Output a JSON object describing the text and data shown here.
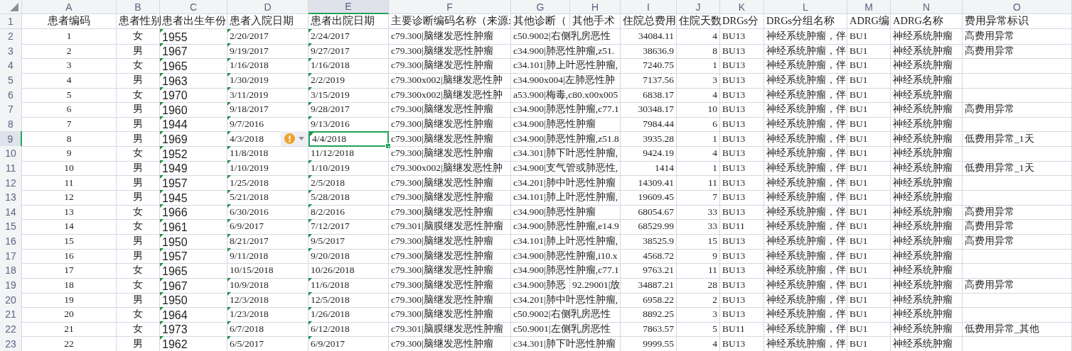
{
  "sheet": {
    "columns": [
      {
        "label": "A",
        "selected": false
      },
      {
        "label": "B",
        "selected": false
      },
      {
        "label": "C",
        "selected": false
      },
      {
        "label": "D",
        "selected": false
      },
      {
        "label": "E",
        "selected": true
      },
      {
        "label": "F",
        "selected": false
      },
      {
        "label": "G",
        "selected": false
      },
      {
        "label": "H",
        "selected": false
      },
      {
        "label": "I",
        "selected": false
      },
      {
        "label": "J",
        "selected": false
      },
      {
        "label": "K",
        "selected": false
      },
      {
        "label": "L",
        "selected": false
      },
      {
        "label": "M",
        "selected": false
      },
      {
        "label": "N",
        "selected": false
      },
      {
        "label": "O",
        "selected": false
      }
    ],
    "header_row": {
      "number": "1",
      "selected": false,
      "cells": [
        "患者编码",
        "患者性别",
        "患者出生年份",
        "患者入院日期",
        "患者出院日期",
        "主要诊断编码名称（来源:",
        "其他诊断（",
        "其他手术",
        "住院总费用",
        "住院天数",
        "DRGs分",
        "DRGs分组名称",
        "ADRG编",
        "ADRG名称",
        "费用异常标识"
      ]
    },
    "rows": [
      {
        "number": "2",
        "selected": false,
        "id": "1",
        "sex": "女",
        "birth_year": "1955",
        "admit_date": "2/20/2017",
        "discharge_date": "2/24/2017",
        "main_diagnosis": "c79.300|脑继发恶性肿瘤",
        "other_diagnosis": "c50.9002|右侧乳房恶性",
        "total_cost": "34084.11",
        "days": "4",
        "drg_code": "BU13",
        "drg_name": "神经系统肿瘤，伴",
        "adrg_code": "BU1",
        "adrg_name": "神经系统肿瘤",
        "cost_flag": "高费用异常",
        "markers": [
          true,
          true,
          true
        ],
        "admit_warning": false,
        "discharge_cell_selected": false
      },
      {
        "number": "3",
        "selected": false,
        "id": "2",
        "sex": "男",
        "birth_year": "1967",
        "admit_date": "9/19/2017",
        "discharge_date": "9/27/2017",
        "main_diagnosis": "c79.300|脑继发恶性肿瘤",
        "other_diagnosis": "c34.900|肺恶性肿瘤,z51.",
        "total_cost": "38636.9",
        "days": "8",
        "drg_code": "BU13",
        "drg_name": "神经系统肿瘤，伴",
        "adrg_code": "BU1",
        "adrg_name": "神经系统肿瘤",
        "cost_flag": "高费用异常",
        "markers": [
          true,
          true,
          true
        ],
        "admit_warning": false,
        "discharge_cell_selected": false
      },
      {
        "number": "4",
        "selected": false,
        "id": "3",
        "sex": "女",
        "birth_year": "1965",
        "admit_date": "1/16/2018",
        "discharge_date": "1/16/2018",
        "main_diagnosis": "c79.300|脑继发恶性肿瘤",
        "other_diagnosis": "c34.101|肺上叶恶性肿瘤,",
        "total_cost": "7240.75",
        "days": "1",
        "drg_code": "BU13",
        "drg_name": "神经系统肿瘤，伴",
        "adrg_code": "BU1",
        "adrg_name": "神经系统肿瘤",
        "markers": [
          true,
          true,
          true
        ],
        "admit_warning": false,
        "discharge_cell_selected": false
      },
      {
        "number": "5",
        "selected": false,
        "id": "4",
        "sex": "男",
        "birth_year": "1963",
        "admit_date": "1/30/2019",
        "discharge_date": "2/2/2019",
        "main_diagnosis": "c79.300x002|脑继发恶性肿",
        "other_diagnosis": "c34.900x004|左肺恶性肿",
        "total_cost": "7137.56",
        "days": "3",
        "drg_code": "BU13",
        "drg_name": "神经系统肿瘤，伴",
        "adrg_code": "BU1",
        "adrg_name": "神经系统肿瘤",
        "markers": [
          true,
          true,
          true
        ],
        "admit_warning": false,
        "discharge_cell_selected": false
      },
      {
        "number": "6",
        "selected": false,
        "id": "5",
        "sex": "女",
        "birth_year": "1970",
        "admit_date": "3/11/2019",
        "discharge_date": "3/15/2019",
        "main_diagnosis": "c79.300x002|脑继发恶性肿",
        "other_diagnosis": "a53.900|梅毒,c80.x00x005",
        "total_cost": "6838.17",
        "days": "4",
        "drg_code": "BU13",
        "drg_name": "神经系统肿瘤，伴",
        "adrg_code": "BU1",
        "adrg_name": "神经系统肿瘤",
        "markers": [
          true,
          true,
          true
        ],
        "admit_warning": false,
        "discharge_cell_selected": false
      },
      {
        "number": "7",
        "selected": false,
        "id": "6",
        "sex": "男",
        "birth_year": "1960",
        "admit_date": "9/18/2017",
        "discharge_date": "9/28/2017",
        "main_diagnosis": "c79.300|脑继发恶性肿瘤",
        "other_diagnosis": "c34.900|肺恶性肿瘤,c77.1",
        "total_cost": "30348.17",
        "days": "10",
        "drg_code": "BU13",
        "drg_name": "神经系统肿瘤，伴",
        "adrg_code": "BU1",
        "adrg_name": "神经系统肿瘤",
        "cost_flag": "高费用异常",
        "markers": [
          true,
          true,
          true
        ],
        "admit_warning": false,
        "discharge_cell_selected": false
      },
      {
        "number": "8",
        "selected": false,
        "id": "7",
        "sex": "男",
        "birth_year": "1944",
        "admit_date": "9/7/2016",
        "discharge_date": "9/13/2016",
        "main_diagnosis": "c79.300|脑继发恶性肿瘤",
        "other_diagnosis": "c34.900|肺恶性肿瘤",
        "total_cost": "7984.44",
        "days": "6",
        "drg_code": "BU13",
        "drg_name": "神经系统肿瘤，伴",
        "adrg_code": "BU1",
        "adrg_name": "神经系统肿瘤",
        "markers": [
          true,
          true,
          true
        ],
        "admit_warning": false,
        "discharge_cell_selected": false
      },
      {
        "number": "9",
        "selected": true,
        "id": "8",
        "sex": "男",
        "birth_year": "1969",
        "admit_date": "4/3/2018",
        "discharge_date": "4/4/2018",
        "main_diagnosis": "c79.300|脑继发恶性肿瘤",
        "other_diagnosis": "c34.900|肺恶性肿瘤,z51.8",
        "total_cost": "3935.28",
        "days": "1",
        "drg_code": "BU13",
        "drg_name": "神经系统肿瘤，伴",
        "adrg_code": "BU1",
        "adrg_name": "神经系统肿瘤",
        "cost_flag": "低费用异常_1天",
        "markers": [
          true,
          true,
          true
        ],
        "admit_warning": true,
        "discharge_cell_selected": true
      },
      {
        "number": "10",
        "selected": false,
        "id": "9",
        "sex": "女",
        "birth_year": "1952",
        "admit_date": "11/8/2018",
        "discharge_date": "11/12/2018",
        "main_diagnosis": "c79.300|脑继发恶性肿瘤",
        "other_diagnosis": "c34.301|肺下叶恶性肿瘤,",
        "total_cost": "9424.19",
        "days": "4",
        "drg_code": "BU13",
        "drg_name": "神经系统肿瘤，伴",
        "adrg_code": "BU1",
        "adrg_name": "神经系统肿瘤",
        "markers": [
          true,
          true,
          false
        ],
        "admit_warning": false,
        "discharge_cell_selected": false
      },
      {
        "number": "11",
        "selected": false,
        "id": "10",
        "sex": "男",
        "birth_year": "1949",
        "admit_date": "1/10/2019",
        "discharge_date": "1/10/2019",
        "main_diagnosis": "c79.300x002|脑继发恶性肿",
        "other_diagnosis": "c34.900|支气管或肺恶性,",
        "total_cost": "1414",
        "days": "1",
        "drg_code": "BU13",
        "drg_name": "神经系统肿瘤，伴",
        "adrg_code": "BU1",
        "adrg_name": "神经系统肿瘤",
        "cost_flag": "低费用异常_1天",
        "markers": [
          true,
          true,
          true
        ],
        "admit_warning": false,
        "discharge_cell_selected": false
      },
      {
        "number": "12",
        "selected": false,
        "id": "11",
        "sex": "男",
        "birth_year": "1957",
        "admit_date": "1/25/2018",
        "discharge_date": "2/5/2018",
        "main_diagnosis": "c79.300|脑继发恶性肿瘤",
        "other_diagnosis": "c34.201|肺中叶恶性肿瘤",
        "total_cost": "14309.41",
        "days": "11",
        "drg_code": "BU13",
        "drg_name": "神经系统肿瘤，伴",
        "adrg_code": "BU1",
        "adrg_name": "神经系统肿瘤",
        "markers": [
          true,
          true,
          true
        ],
        "admit_warning": false,
        "discharge_cell_selected": false
      },
      {
        "number": "13",
        "selected": false,
        "id": "12",
        "sex": "男",
        "birth_year": "1945",
        "admit_date": "5/21/2018",
        "discharge_date": "5/28/2018",
        "main_diagnosis": "c79.300|脑继发恶性肿瘤",
        "other_diagnosis": "c34.101|肺上叶恶性肿瘤,",
        "total_cost": "19609.45",
        "days": "7",
        "drg_code": "BU13",
        "drg_name": "神经系统肿瘤，伴",
        "adrg_code": "BU1",
        "adrg_name": "神经系统肿瘤",
        "markers": [
          true,
          true,
          true
        ],
        "admit_warning": false,
        "discharge_cell_selected": false
      },
      {
        "number": "14",
        "selected": false,
        "id": "13",
        "sex": "女",
        "birth_year": "1966",
        "admit_date": "6/30/2016",
        "discharge_date": "8/2/2016",
        "main_diagnosis": "c79.300|脑继发恶性肿瘤",
        "other_diagnosis": "c34.900|肺恶性肿瘤",
        "total_cost": "68054.67",
        "days": "33",
        "drg_code": "BU13",
        "drg_name": "神经系统肿瘤，伴",
        "adrg_code": "BU1",
        "adrg_name": "神经系统肿瘤",
        "cost_flag": "高费用异常",
        "markers": [
          true,
          true,
          true
        ],
        "admit_warning": false,
        "discharge_cell_selected": false
      },
      {
        "number": "15",
        "selected": false,
        "id": "14",
        "sex": "女",
        "birth_year": "1961",
        "admit_date": "6/9/2017",
        "discharge_date": "7/12/2017",
        "main_diagnosis": "c79.301|脑膜继发恶性肿瘤",
        "other_diagnosis": "c34.900|肺恶性肿瘤,e14.9",
        "total_cost": "68529.99",
        "days": "33",
        "drg_code": "BU11",
        "drg_name": "神经系统肿瘤，伴",
        "adrg_code": "BU1",
        "adrg_name": "神经系统肿瘤",
        "cost_flag": "高费用异常",
        "markers": [
          true,
          true,
          true
        ],
        "admit_warning": false,
        "discharge_cell_selected": false
      },
      {
        "number": "16",
        "selected": false,
        "id": "15",
        "sex": "男",
        "birth_year": "1950",
        "admit_date": "8/21/2017",
        "discharge_date": "9/5/2017",
        "main_diagnosis": "c79.300|脑继发恶性肿瘤",
        "other_diagnosis": "c34.101|肺上叶恶性肿瘤,",
        "total_cost": "38525.9",
        "days": "15",
        "drg_code": "BU13",
        "drg_name": "神经系统肿瘤，伴",
        "adrg_code": "BU1",
        "adrg_name": "神经系统肿瘤",
        "cost_flag": "高费用异常",
        "markers": [
          true,
          true,
          true
        ],
        "admit_warning": false,
        "discharge_cell_selected": false
      },
      {
        "number": "17",
        "selected": false,
        "id": "16",
        "sex": "男",
        "birth_year": "1957",
        "admit_date": "9/11/2018",
        "discharge_date": "9/20/2018",
        "main_diagnosis": "c79.300|脑继发恶性肿瘤",
        "other_diagnosis": "c34.900|肺恶性肿瘤,i10.x",
        "total_cost": "4568.72",
        "days": "9",
        "drg_code": "BU13",
        "drg_name": "神经系统肿瘤，伴",
        "adrg_code": "BU1",
        "adrg_name": "神经系统肿瘤",
        "markers": [
          true,
          true,
          true
        ],
        "admit_warning": false,
        "discharge_cell_selected": false
      },
      {
        "number": "18",
        "selected": false,
        "id": "17",
        "sex": "女",
        "birth_year": "1965",
        "admit_date": "10/15/2018",
        "discharge_date": "10/26/2018",
        "main_diagnosis": "c79.300|脑继发恶性肿瘤",
        "other_diagnosis": "c34.900|肺恶性肿瘤,c77.1",
        "total_cost": "9763.21",
        "days": "11",
        "drg_code": "BU13",
        "drg_name": "神经系统肿瘤，伴",
        "adrg_code": "BU1",
        "adrg_name": "神经系统肿瘤",
        "markers": [
          true,
          false,
          false
        ],
        "admit_warning": false,
        "discharge_cell_selected": false
      },
      {
        "number": "19",
        "selected": false,
        "id": "18",
        "sex": "女",
        "birth_year": "1967",
        "admit_date": "10/9/2018",
        "discharge_date": "11/6/2018",
        "main_diagnosis": "c79.300|脑继发恶性肿瘤",
        "other_diagnosis": "c34.900|肺恶",
        "other_surgery": "92.29001|放",
        "total_cost": "34887.21",
        "days": "28",
        "drg_code": "BU13",
        "drg_name": "神经系统肿瘤，伴",
        "adrg_code": "BU1",
        "adrg_name": "神经系统肿瘤",
        "cost_flag": "高费用异常",
        "markers": [
          true,
          true,
          true
        ],
        "admit_warning": false,
        "discharge_cell_selected": false
      },
      {
        "number": "20",
        "selected": false,
        "id": "19",
        "sex": "男",
        "birth_year": "1950",
        "admit_date": "12/3/2018",
        "discharge_date": "12/5/2018",
        "main_diagnosis": "c79.300|脑继发恶性肿瘤",
        "other_diagnosis": "c34.201|肺中叶恶性肿瘤,",
        "total_cost": "6958.22",
        "days": "2",
        "drg_code": "BU13",
        "drg_name": "神经系统肿瘤，伴",
        "adrg_code": "BU1",
        "adrg_name": "神经系统肿瘤",
        "markers": [
          true,
          true,
          true
        ],
        "admit_warning": false,
        "discharge_cell_selected": false
      },
      {
        "number": "21",
        "selected": false,
        "id": "20",
        "sex": "女",
        "birth_year": "1964",
        "admit_date": "1/23/2018",
        "discharge_date": "1/26/2018",
        "main_diagnosis": "c79.300|脑继发恶性肿瘤",
        "other_diagnosis": "c50.9002|右侧乳房恶性",
        "total_cost": "8892.25",
        "days": "3",
        "drg_code": "BU13",
        "drg_name": "神经系统肿瘤，伴",
        "adrg_code": "BU1",
        "adrg_name": "神经系统肿瘤",
        "markers": [
          true,
          true,
          true
        ],
        "admit_warning": false,
        "discharge_cell_selected": false
      },
      {
        "number": "22",
        "selected": false,
        "id": "21",
        "sex": "女",
        "birth_year": "1973",
        "admit_date": "6/7/2018",
        "discharge_date": "6/12/2018",
        "main_diagnosis": "c79.301|脑膜继发恶性肿瘤",
        "other_diagnosis": "c50.9001|左侧乳房恶性",
        "total_cost": "7863.57",
        "days": "5",
        "drg_code": "BU11",
        "drg_name": "神经系统肿瘤，伴",
        "adrg_code": "BU1",
        "adrg_name": "神经系统肿瘤",
        "cost_flag": "低费用异常_其他",
        "markers": [
          true,
          true,
          true
        ],
        "admit_warning": false,
        "discharge_cell_selected": false
      },
      {
        "number": "23",
        "selected": false,
        "id": "22",
        "sex": "男",
        "birth_year": "1962",
        "admit_date": "6/5/2017",
        "discharge_date": "6/9/2017",
        "main_diagnosis": "c79.300|脑继发恶性肿瘤",
        "other_diagnosis": "c34.301|肺下叶恶性肿瘤",
        "total_cost": "9999.55",
        "days": "4",
        "drg_code": "BU13",
        "drg_name": "神经系统肿瘤，伴",
        "adrg_code": "BU1",
        "adrg_name": "神经系统肿瘤",
        "markers": [
          true,
          true,
          true
        ],
        "admit_warning": false,
        "discharge_cell_selected": false
      }
    ]
  }
}
